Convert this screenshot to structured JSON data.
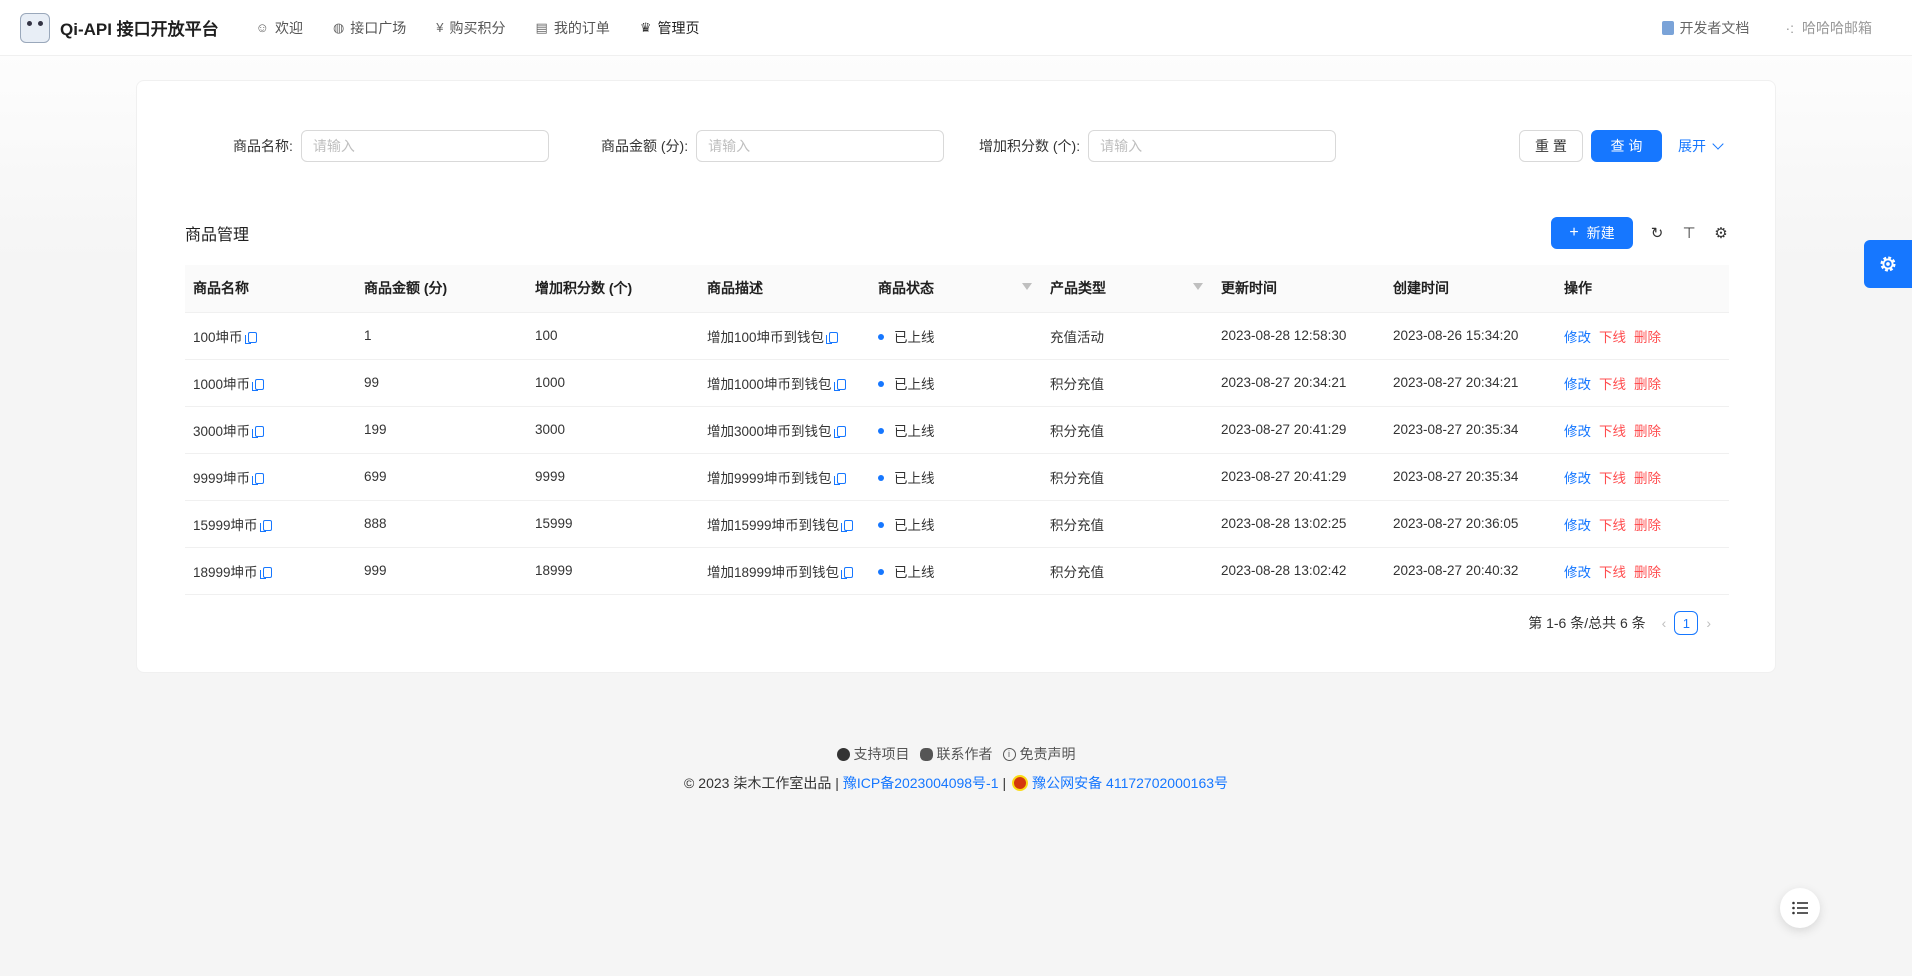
{
  "header": {
    "title": "Qi-API 接口开放平台",
    "nav": [
      {
        "label": "欢迎",
        "icon": "smile-icon"
      },
      {
        "label": "接口广场",
        "icon": "reddit-icon"
      },
      {
        "label": "购买积分",
        "icon": "yuan-icon"
      },
      {
        "label": "我的订单",
        "icon": "order-icon"
      },
      {
        "label": "管理页",
        "icon": "crown-icon"
      }
    ],
    "doc_link": "开发者文档",
    "user_label": "哈哈哈邮箱"
  },
  "search": {
    "fields": [
      {
        "label": "商品名称:",
        "placeholder": "请输入"
      },
      {
        "label": "商品金额 (分):",
        "placeholder": "请输入"
      },
      {
        "label": "增加积分数 (个):",
        "placeholder": "请输入"
      }
    ],
    "reset_label": "重 置",
    "query_label": "查 询",
    "expand_label": "展开"
  },
  "toolbar": {
    "title": "商品管理",
    "new_label": "新建"
  },
  "table": {
    "columns": [
      "商品名称",
      "商品金额 (分)",
      "增加积分数 (个)",
      "商品描述",
      "商品状态",
      "产品类型",
      "更新时间",
      "创建时间",
      "操作"
    ],
    "actions": {
      "edit": "修改",
      "offline": "下线",
      "delete": "删除"
    },
    "rows": [
      {
        "name": "100坤币",
        "amount": "1",
        "points": "100",
        "desc": "增加100坤币到钱包",
        "status": "已上线",
        "type": "充值活动",
        "updated": "2023-08-28 12:58:30",
        "created": "2023-08-26 15:34:20"
      },
      {
        "name": "1000坤币",
        "amount": "99",
        "points": "1000",
        "desc": "增加1000坤币到钱包",
        "status": "已上线",
        "type": "积分充值",
        "updated": "2023-08-27 20:34:21",
        "created": "2023-08-27 20:34:21"
      },
      {
        "name": "3000坤币",
        "amount": "199",
        "points": "3000",
        "desc": "增加3000坤币到钱包",
        "status": "已上线",
        "type": "积分充值",
        "updated": "2023-08-27 20:41:29",
        "created": "2023-08-27 20:35:34"
      },
      {
        "name": "9999坤币",
        "amount": "699",
        "points": "9999",
        "desc": "增加9999坤币到钱包",
        "status": "已上线",
        "type": "积分充值",
        "updated": "2023-08-27 20:41:29",
        "created": "2023-08-27 20:35:34"
      },
      {
        "name": "15999坤币",
        "amount": "888",
        "points": "15999",
        "desc": "增加15999坤币到钱包",
        "status": "已上线",
        "type": "积分充值",
        "updated": "2023-08-28 13:02:25",
        "created": "2023-08-27 20:36:05"
      },
      {
        "name": "18999坤币",
        "amount": "999",
        "points": "18999",
        "desc": "增加18999坤币到钱包",
        "status": "已上线",
        "type": "积分充值",
        "updated": "2023-08-28 13:02:42",
        "created": "2023-08-27 20:40:32"
      }
    ]
  },
  "pagination": {
    "summary": "第 1-6 条/总共 6 条",
    "current": "1"
  },
  "footer": {
    "links": [
      "支持项目",
      "联系作者",
      "免责声明"
    ],
    "copyright": "2023 柒木工作室出品 |",
    "icp": "豫ICP备2023004098号-1",
    "separator": "|",
    "police": "豫公网安备 41172702000163号"
  },
  "colors": {
    "primary": "#1677ff",
    "danger": "#ff4d4f"
  }
}
